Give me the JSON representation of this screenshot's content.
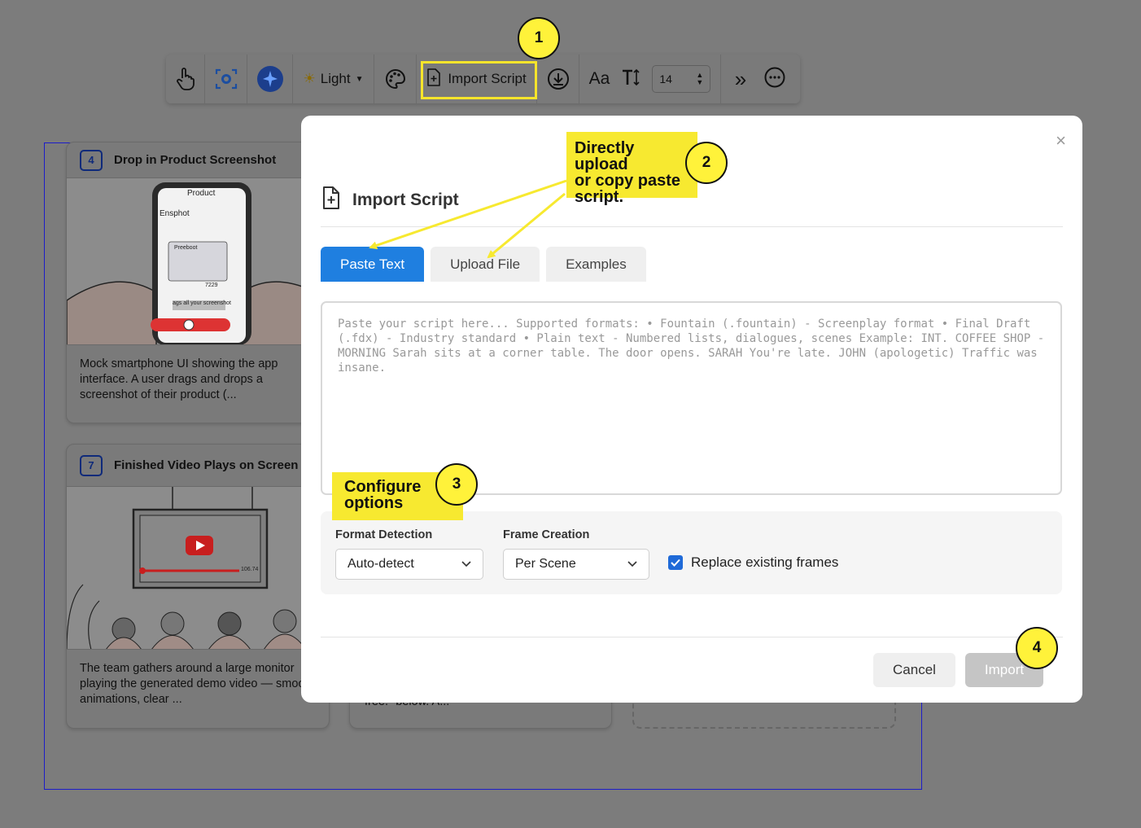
{
  "toolbar": {
    "theme_label": "Light",
    "import_label": "Import Script",
    "font_label": "Aa",
    "font_size_value": "14"
  },
  "cards": [
    {
      "number": "4",
      "title": "Drop in Product Screenshot",
      "desc": "Mock smartphone UI showing the app interface. A user drags and drops a screenshot of their product (...",
      "phone": {
        "header": "Product",
        "subheader": "Ensphot",
        "card_label": "Preeboot",
        "price": "7229",
        "caption": "ags all your screenshot"
      }
    },
    {
      "number": "7",
      "title": "Finished Video Plays on Screen",
      "desc": "The team gathers around a large monitor playing the generated demo video — smooth animations, clear ...",
      "player_time": "106.74"
    }
  ],
  "hidden_card_text": "free.\" below. A...",
  "modal": {
    "title": "Import Script",
    "close_label": "×",
    "tabs": [
      "Paste Text",
      "Upload File",
      "Examples"
    ],
    "active_tab": "Paste Text",
    "placeholder": "Paste your script here... Supported formats: • Fountain (.fountain) - Screenplay format • Final Draft (.fdx) - Industry standard • Plain text - Numbered lists, dialogues, scenes Example: INT. COFFEE SHOP - MORNING Sarah sits at a corner table. The door opens. SARAH You're late. JOHN (apologetic) Traffic was insane.",
    "format_label": "Format Detection",
    "format_value": "Auto-detect",
    "frame_label": "Frame Creation",
    "frame_value": "Per Scene",
    "replace_label": "Replace existing frames",
    "replace_checked": true,
    "cancel_label": "Cancel",
    "import_label": "Import"
  },
  "annotations": {
    "note2_line1": "Directly upload",
    "note2_line2": "or copy paste",
    "note2_line3": "script.",
    "note3_line1": "Configure",
    "note3_line2": "options",
    "b1": "1",
    "b2": "2",
    "b3": "3",
    "b4": "4"
  },
  "colors": {
    "accent": "#1f7fe0",
    "highlight": "#f7e930",
    "overlay": "#7c7c7c",
    "checkbox": "#1f6ad8"
  }
}
